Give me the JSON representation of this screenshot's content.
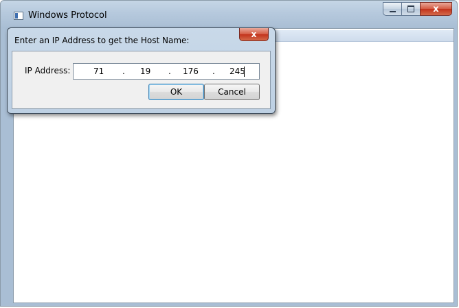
{
  "main_window": {
    "title": "Windows Protocol",
    "caption_buttons": {
      "close": "x"
    }
  },
  "dialog": {
    "title": "Enter an IP Address to get the Host Name:",
    "close_label": "x",
    "ip_label": "IP Address:",
    "ip_octets": [
      "71",
      "19",
      "176",
      "245"
    ],
    "separator": ".",
    "ok_label": "OK",
    "cancel_label": "Cancel"
  },
  "colors": {
    "close_button": "#c2321b",
    "titlebar": "#b6c9dd",
    "default_button_border": "#3c7fb1"
  },
  "icons": [
    "app-window-icon",
    "minimize-icon",
    "maximize-icon",
    "close-icon"
  ]
}
